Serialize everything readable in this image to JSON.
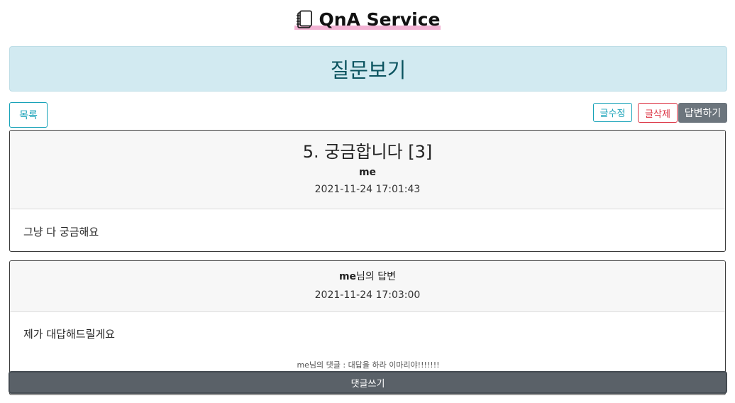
{
  "header": {
    "brand_icon": "notebook-icon",
    "title": "QnA Service"
  },
  "banner": {
    "title": "질문보기"
  },
  "actions": {
    "list_label": "목록",
    "edit_label": "글수정",
    "delete_label": "글삭제",
    "answer_label": "답변하기"
  },
  "question": {
    "title": "5. 궁금합니다 [3]",
    "author": "me",
    "date": "2021-11-24 17:01:43",
    "body": "그냥 다 궁금해요"
  },
  "answer": {
    "author": "me",
    "author_suffix": "님의 답변",
    "date": "2021-11-24 17:03:00",
    "body": "제가 대답해드릴게요",
    "comment": "me님의 댓글 : 대답을 하라 이마리야!!!!!!!"
  },
  "comment_button": {
    "label": "댓글쓰기"
  }
}
